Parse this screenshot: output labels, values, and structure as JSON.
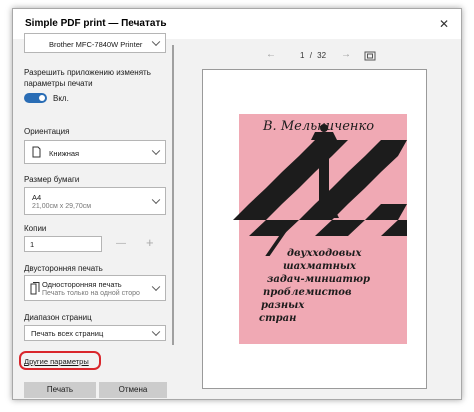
{
  "window": {
    "title": "Simple PDF print — Печатать",
    "close_glyph": "✕"
  },
  "printer": {
    "value": "Brother MFC-7840W Printer"
  },
  "allow_app": {
    "label_line1": "Разрешить приложению изменять",
    "label_line2": "параметры печати",
    "toggle_label": "Вкл.",
    "toggle_on": true
  },
  "orientation": {
    "label": "Ориентация",
    "value": "Книжная"
  },
  "paper": {
    "label": "Размер бумаги",
    "value": "A4",
    "sub": "21,00см x 29,70см"
  },
  "copies": {
    "label": "Копии",
    "value": "1",
    "minus": "—",
    "plus": "+"
  },
  "duplex": {
    "label": "Двусторонняя печать",
    "value": "Односторонняя печать",
    "sub": "Печать только на одной сторо"
  },
  "range": {
    "label": "Диапазон страниц",
    "value": "Печать всех страниц"
  },
  "more": {
    "label": "Другие параметры"
  },
  "buttons": {
    "print": "Печать",
    "cancel": "Отмена"
  },
  "nav": {
    "prev": "←",
    "page_current": "1",
    "page_sep": "/",
    "page_total": "32",
    "next": "→"
  },
  "cover": {
    "author": "В. Мельниченко",
    "number": "7",
    "lines": [
      "двухходовых",
      "шахматных",
      "задач-миниатюр",
      "проблемистов",
      "разных",
      "стран"
    ]
  },
  "colors": {
    "accent": "#2a6db5",
    "highlight": "#d9262c",
    "cover_pink": "#f0a9b4",
    "cover_ink": "#1c1c1c"
  }
}
